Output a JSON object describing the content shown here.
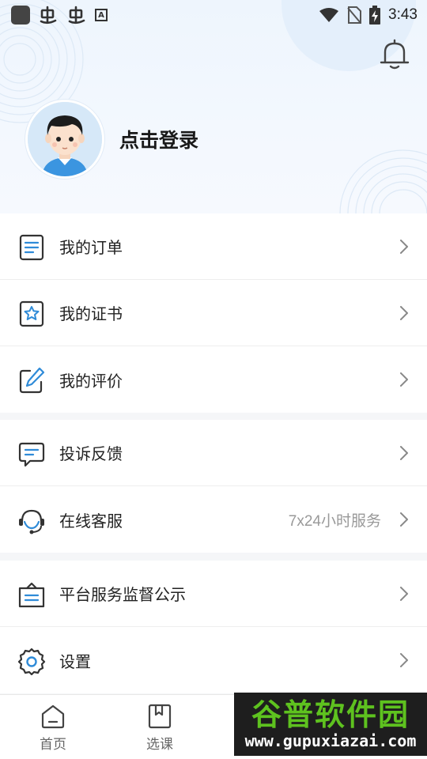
{
  "status_bar": {
    "time": "3:43",
    "left_icons": [
      "app-square-icon",
      "bug-icon",
      "bug-icon",
      "a-letter-icon"
    ],
    "a_letter": "A",
    "right_icons": [
      "wifi-icon",
      "no-sim-icon",
      "battery-charging-icon"
    ]
  },
  "profile": {
    "login_label": "点击登录"
  },
  "menu_groups": [
    [
      {
        "label": "我的订单",
        "icon": "order-list-icon"
      },
      {
        "label": "我的证书",
        "icon": "certificate-star-icon"
      },
      {
        "label": "我的评价",
        "icon": "edit-review-icon"
      }
    ],
    [
      {
        "label": "投诉反馈",
        "icon": "feedback-message-icon"
      },
      {
        "label": "在线客服",
        "icon": "headset-icon",
        "extra": "7x24小时服务"
      }
    ],
    [
      {
        "label": "平台服务监督公示",
        "icon": "notice-board-icon"
      },
      {
        "label": "设置",
        "icon": "gear-icon"
      }
    ]
  ],
  "tabbar": {
    "tabs": [
      {
        "label": "首页",
        "icon": "home-icon"
      },
      {
        "label": "选课",
        "icon": "book-icon"
      }
    ]
  },
  "watermark": {
    "title": "谷普软件园",
    "url": "www.gupuxiazai.com"
  },
  "colors": {
    "accent": "#2f8bd8",
    "icon_dark": "#333333",
    "header_bg": "#eef5fd",
    "watermark_green": "#5ec21f"
  }
}
